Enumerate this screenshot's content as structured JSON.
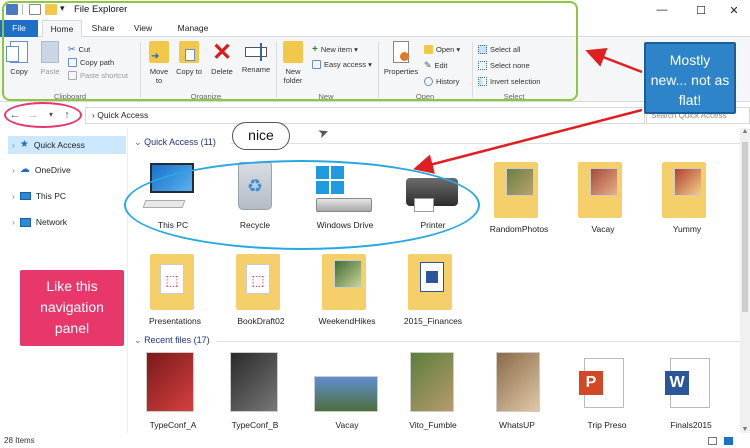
{
  "window": {
    "title": "File Explorer",
    "min": "—",
    "max": "☐",
    "close": "✕"
  },
  "tabs": [
    "File",
    "Home",
    "Share",
    "View",
    "Manage"
  ],
  "ribbon": {
    "copy": "Copy",
    "paste": "Paste",
    "cut": "Cut",
    "copy_path": "Copy path",
    "paste_shortcut": "Paste shortcut",
    "move_to": "Move to",
    "copy_to": "Copy to",
    "delete": "Delete",
    "rename": "Rename",
    "new_folder": "New folder",
    "new_item": "New item ▾",
    "easy_access": "Easy access ▾",
    "properties": "Properties",
    "open": "Open ▾",
    "edit": "Edit",
    "history": "History",
    "select_all": "Select all",
    "select_none": "Select none",
    "invert_selection": "Invert selection",
    "groups": {
      "clipboard": "Clipboard",
      "organize": "Organize",
      "new": "New",
      "open": "Open",
      "select": "Select"
    }
  },
  "address": {
    "path": "Quick Access",
    "search_placeholder": "Search Quick Access"
  },
  "nav": [
    {
      "label": "Quick Access",
      "selected": true
    },
    {
      "label": "OneDrive"
    },
    {
      "label": "This PC"
    },
    {
      "label": "Network"
    }
  ],
  "quick_access": {
    "header": "Quick Access (11)",
    "row1": [
      "This PC",
      "Recycle",
      "Windows Drive",
      "Printer",
      "RandomPhotos",
      "Vacay",
      "Yummy"
    ],
    "row2": [
      "Presentations",
      "BookDraft02",
      "WeekendHikes",
      "2015_Finances"
    ]
  },
  "recent": {
    "header": "Recent files (17)",
    "items": [
      "TypeConf_A",
      "TypeConf_B",
      "Vacay",
      "Vito_Fumble",
      "WhatsUP",
      "Trip Preso",
      "Finals2015"
    ]
  },
  "status": "28 Items",
  "callouts": {
    "nice": "nice",
    "mostly_new": "Mostly new... not as flat!",
    "nav_panel": "Like this navigation panel"
  },
  "colors": {
    "accent": "#1e6fc6",
    "callout_blue": "#2e84c9",
    "callout_pink": "#e8376a",
    "highlight_green": "#8dc63f",
    "ring_blue": "#29a8e0",
    "arrow_red": "#e02020"
  }
}
